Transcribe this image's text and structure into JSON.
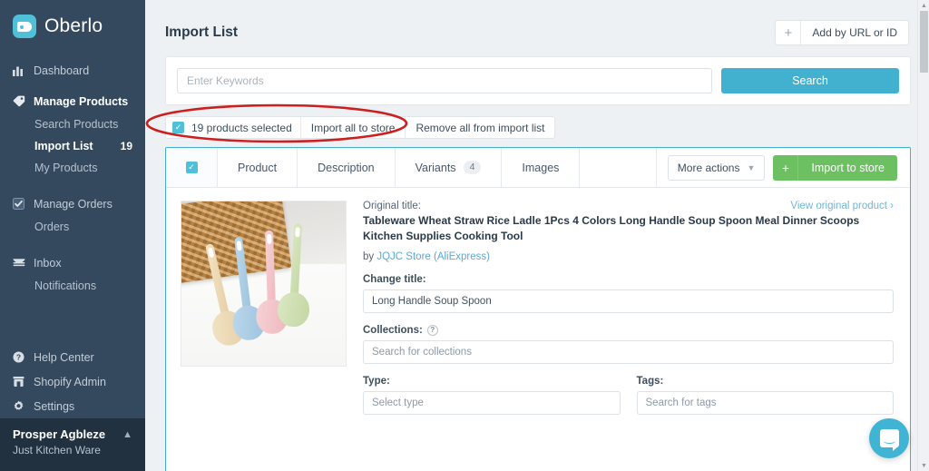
{
  "sidebar": {
    "brand": "Oberlo",
    "brand_icon": "oberlo-tag-logo",
    "nav": [
      {
        "label": "Dashboard",
        "icon": "bar-chart-icon",
        "bold": false
      },
      {
        "label": "Manage Products",
        "icon": "tag-icon",
        "bold": true
      },
      {
        "label": "Manage Orders",
        "icon": "checkbox-square-icon",
        "bold": false
      },
      {
        "label": "Inbox",
        "icon": "envelope-icon",
        "bold": false
      }
    ],
    "product_subitems": [
      {
        "label": "Search Products",
        "badge": "",
        "active": false
      },
      {
        "label": "Import List",
        "badge": "19",
        "active": true
      },
      {
        "label": "My Products",
        "badge": "",
        "active": false
      }
    ],
    "order_subitems": [
      {
        "label": "Orders",
        "badge": "",
        "active": false
      }
    ],
    "inbox_subitems": [
      {
        "label": "Notifications",
        "badge": "",
        "active": false
      }
    ],
    "bottom_nav": [
      {
        "label": "Help Center",
        "icon": "question-circle-icon"
      },
      {
        "label": "Shopify Admin",
        "icon": "store-icon"
      },
      {
        "label": "Settings",
        "icon": "gear-icon"
      }
    ],
    "user": {
      "name": "Prosper Agbleze",
      "store": "Just Kitchen Ware",
      "caret_icon": "chevron-up-icon"
    }
  },
  "header": {
    "title": "Import List",
    "add_by_url_label": "Add by URL or ID",
    "add_icon": "plus-icon"
  },
  "search": {
    "placeholder": "Enter Keywords",
    "value": "",
    "button_label": "Search"
  },
  "selection_bar": {
    "checkbox_icon": "checkbox-checked-icon",
    "selected_label": "19 products selected",
    "import_all_label": "Import all to store",
    "remove_all_label": "Remove all from import list"
  },
  "product_card": {
    "checkbox_icon": "checkbox-checked-icon",
    "tabs": [
      {
        "label": "Product",
        "count": ""
      },
      {
        "label": "Description",
        "count": ""
      },
      {
        "label": "Variants",
        "count": "4"
      },
      {
        "label": "Images",
        "count": ""
      }
    ],
    "more_actions_label": "More actions",
    "more_actions_caret": "chevron-down-icon",
    "import_to_store_label": "Import to store",
    "import_plus_icon": "plus-icon",
    "thumbnail_alt": "four pastel long-handle soup ladles on white table with wicker basket",
    "original_title_label": "Original title:",
    "original_title": "Tableware Wheat Straw Rice Ladle 1Pcs 4 Colors Long Handle Soup Spoon Meal Dinner Scoops Kitchen Supplies Cooking Tool",
    "view_original_label": "View original product",
    "view_original_caret": "chevron-right-icon",
    "by_prefix": "by",
    "supplier": "JQJC Store (AliExpress)",
    "fields": {
      "change_title_label": "Change title:",
      "change_title_value": "Long Handle Soup Spoon",
      "collections_label": "Collections:",
      "collections_help_icon": "question-mark-icon",
      "collections_placeholder": "Search for collections",
      "type_label": "Type:",
      "type_placeholder": "Select type",
      "tags_label": "Tags:",
      "tags_placeholder": "Search for tags"
    }
  },
  "chat": {
    "icon": "chat-bubble-icon"
  },
  "scrollbar": {
    "up_icon": "triangle-up-icon",
    "down_icon": "triangle-down-icon"
  },
  "annotation": {
    "shape": "red-ellipse-highlight",
    "color": "#cc1f1f"
  },
  "colors": {
    "sidebar_bg": "#34495e",
    "user_panel_bg": "#22313f",
    "accent_cyan": "#42b0cf",
    "accent_green": "#6cc062",
    "page_bg": "#eef1f4",
    "link_blue": "#5aa9d6"
  }
}
